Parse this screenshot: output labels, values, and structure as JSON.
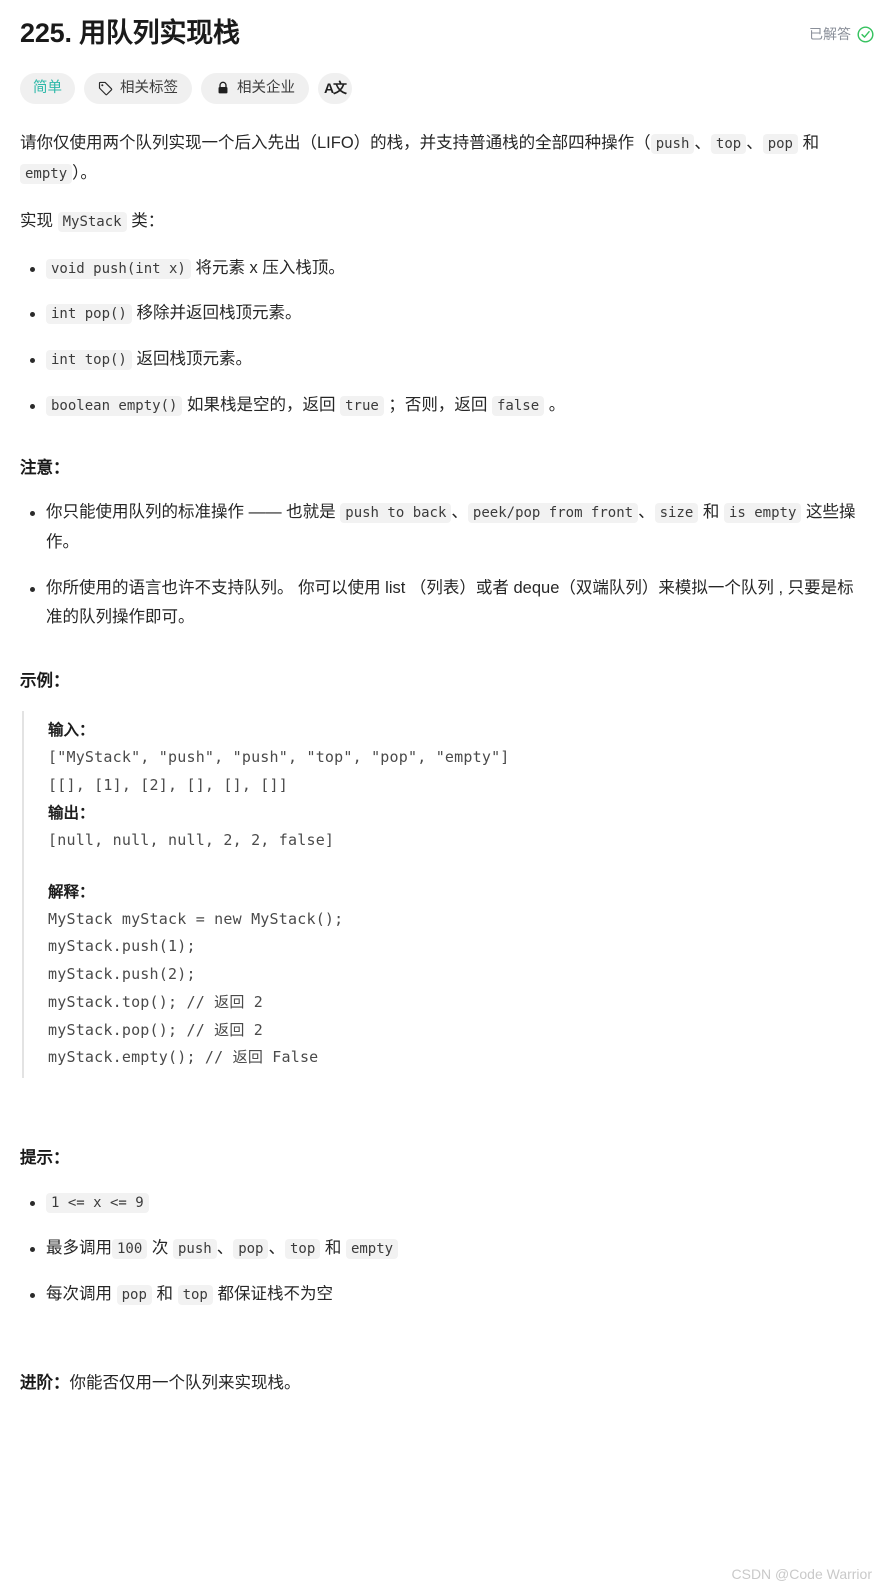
{
  "header": {
    "title_number": "225.",
    "title_text": "用队列实现栈",
    "status_label": "已解答",
    "status_icon": "check-circle-icon",
    "status_color": "#36c25f"
  },
  "tags": {
    "difficulty": {
      "label": "简单",
      "color": "#2bb8a8"
    },
    "related_topics": {
      "label": "相关标签",
      "icon": "tag-icon"
    },
    "related_companies": {
      "label": "相关企业",
      "icon": "lock-icon"
    },
    "translate": {
      "label": "A文",
      "icon": "translate-icon"
    }
  },
  "description": {
    "intro_1": "请你仅使用两个队列实现一个后入先出（LIFO）的栈，并支持普通栈的全部四种操作（",
    "intro_code_1": "push",
    "intro_2": "、",
    "intro_code_2": "top",
    "intro_3": "、",
    "intro_code_3": "pop",
    "intro_4": " 和 ",
    "intro_code_4": "empty",
    "intro_5": "）。",
    "implement_prefix": "实现 ",
    "implement_code": "MyStack",
    "implement_suffix": " 类：",
    "methods": [
      {
        "code": "void push(int x)",
        "text": " 将元素 x 压入栈顶。"
      },
      {
        "code": "int pop()",
        "text": " 移除并返回栈顶元素。"
      },
      {
        "code": "int top()",
        "text": " 返回栈顶元素。"
      },
      {
        "code": "boolean empty()",
        "text_a": " 如果栈是空的，返回 ",
        "code_b": "true",
        "text_b": " ；否则，返回 ",
        "code_c": "false",
        "text_c": " 。"
      }
    ]
  },
  "notes": {
    "heading": "注意：",
    "item1_a": "你只能使用队列的标准操作 —— 也就是 ",
    "item1_code1": "push to back",
    "item1_b": "、",
    "item1_code2": "peek/pop from front",
    "item1_c": "、",
    "item1_code3": "size",
    "item1_d": " 和 ",
    "item1_code4": "is empty",
    "item1_e": " 这些操作。",
    "item2": "你所使用的语言也许不支持队列。 你可以使用 list （列表）或者 deque（双端队列）来模拟一个队列 , 只要是标准的队列操作即可。"
  },
  "example": {
    "heading": "示例：",
    "input_label": "输入：",
    "input_lines": "[\"MyStack\", \"push\", \"push\", \"top\", \"pop\", \"empty\"]\n[[], [1], [2], [], [], []]",
    "output_label": "输出：",
    "output_lines": "[null, null, null, 2, 2, false]",
    "explain_label": "解释：",
    "explain_lines": "MyStack myStack = new MyStack();\nmyStack.push(1);\nmyStack.push(2);\nmyStack.top(); // 返回 2\nmyStack.pop(); // 返回 2\nmyStack.empty(); // 返回 False"
  },
  "hints": {
    "heading": "提示：",
    "item1_code": "1 <= x <= 9",
    "item2_a": "最多调用",
    "item2_code1": "100",
    "item2_b": " 次 ",
    "item2_code2": "push",
    "item2_c": "、",
    "item2_code3": "pop",
    "item2_d": "、",
    "item2_code4": "top",
    "item2_e": " 和 ",
    "item2_code5": "empty",
    "item3_a": "每次调用 ",
    "item3_code1": "pop",
    "item3_b": " 和 ",
    "item3_code2": "top",
    "item3_c": " 都保证栈不为空"
  },
  "advanced": {
    "label": "进阶：",
    "text": "你能否仅用一个队列来实现栈。"
  },
  "watermark": "CSDN @Code Warrior"
}
